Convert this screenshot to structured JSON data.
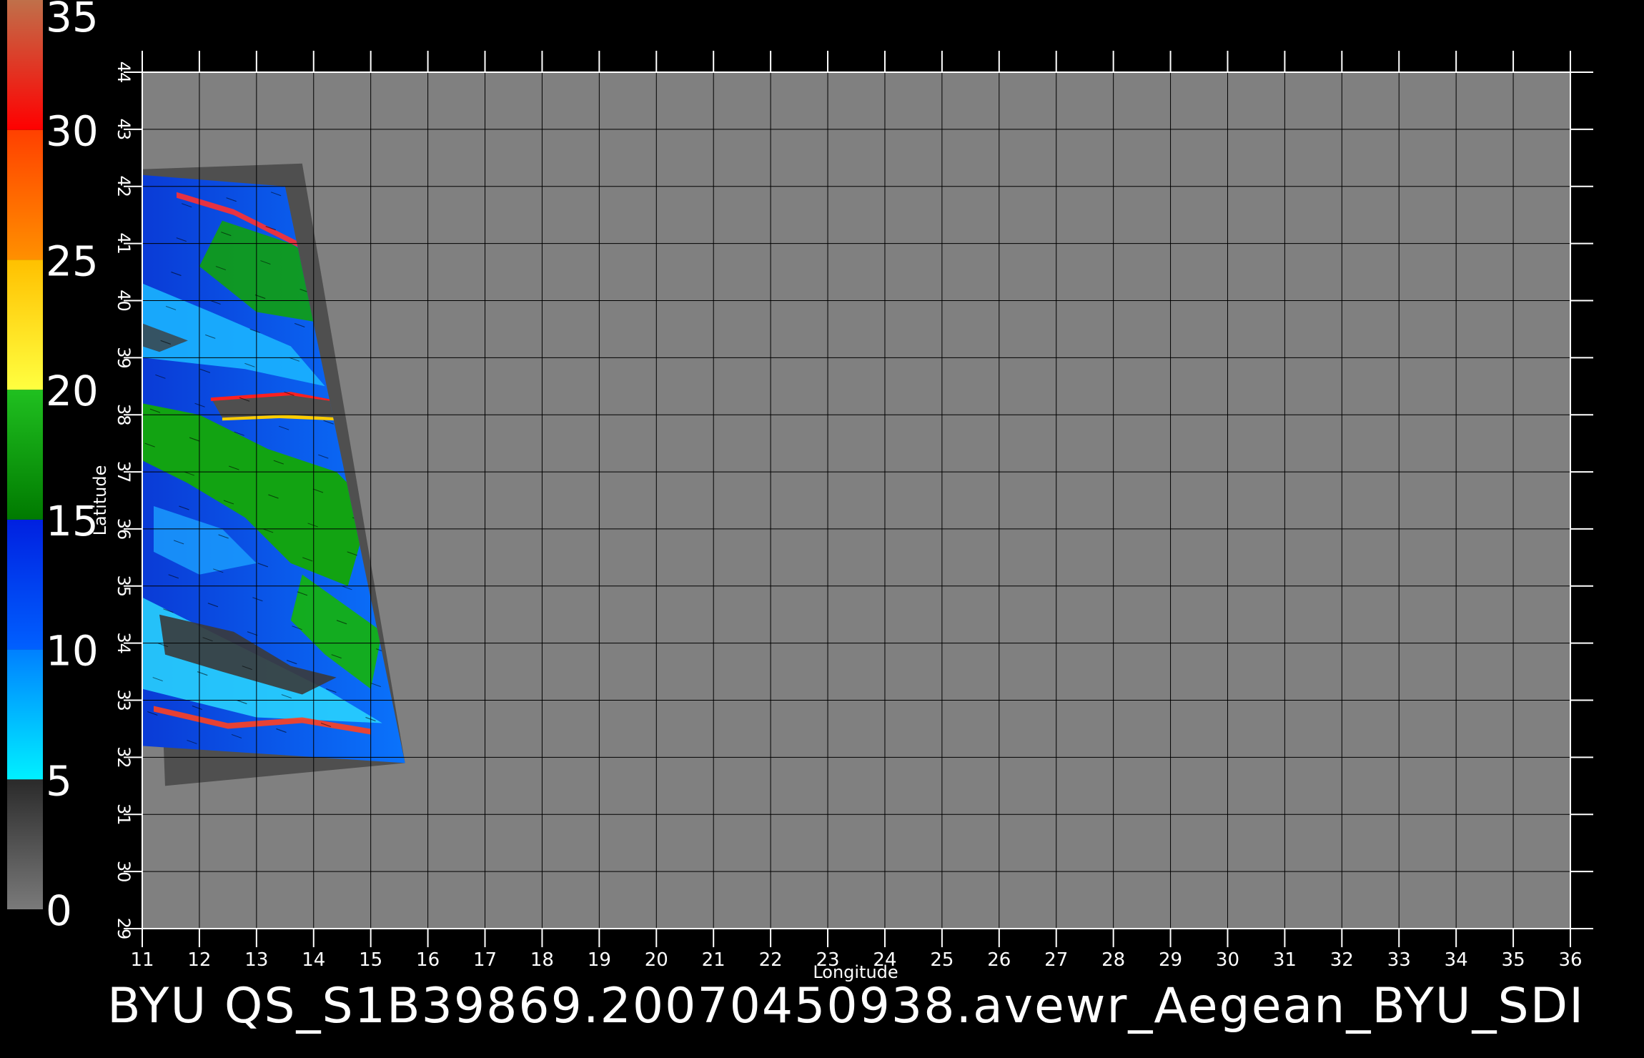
{
  "chart_data": {
    "type": "heatmap",
    "title": "BYU QS_S1B39869.20070450938.avewr_Aegean_BYU_SDI",
    "xlabel": "Longitude",
    "ylabel": "Latitude",
    "xlim": [
      11,
      36
    ],
    "ylim": [
      29,
      44
    ],
    "x_ticks": [
      "11",
      "12",
      "13",
      "14",
      "15",
      "16",
      "17",
      "18",
      "19",
      "20",
      "21",
      "22",
      "23",
      "24",
      "25",
      "26",
      "27",
      "28",
      "29",
      "30",
      "31",
      "32",
      "33",
      "34",
      "35",
      "36"
    ],
    "y_ticks": [
      "29",
      "30",
      "31",
      "32",
      "33",
      "34",
      "35",
      "36",
      "37",
      "38",
      "39",
      "40",
      "41",
      "42",
      "43",
      "44"
    ],
    "grid": true,
    "colorbar": {
      "range": [
        0,
        35
      ],
      "ticks": [
        "0",
        "5",
        "10",
        "15",
        "20",
        "25",
        "30",
        "35"
      ],
      "bands": [
        {
          "from": 0,
          "to": 5,
          "colors": [
            "#7a7a7a",
            "#2a2a2a"
          ]
        },
        {
          "from": 5,
          "to": 10,
          "colors": [
            "#00f0ff",
            "#0080ff"
          ]
        },
        {
          "from": 10,
          "to": 15,
          "colors": [
            "#0060ff",
            "#0020e0"
          ]
        },
        {
          "from": 15,
          "to": 20,
          "colors": [
            "#007a00",
            "#20c020"
          ]
        },
        {
          "from": 20,
          "to": 25,
          "colors": [
            "#ffff40",
            "#ffc000"
          ]
        },
        {
          "from": 25,
          "to": 30,
          "colors": [
            "#ff9000",
            "#ff4000"
          ]
        },
        {
          "from": 30,
          "to": 35,
          "colors": [
            "#ff0000",
            "#c0704a"
          ]
        }
      ]
    },
    "swath": {
      "corners_lonlat": [
        [
          11.0,
          42.3
        ],
        [
          13.8,
          42.4
        ],
        [
          15.6,
          31.9
        ],
        [
          11.4,
          31.5
        ]
      ],
      "data_region_lonlat": [
        [
          11.0,
          42.2
        ],
        [
          13.5,
          42.0
        ],
        [
          15.6,
          31.9
        ],
        [
          11.0,
          32.2
        ]
      ]
    },
    "colors": {
      "background": "#000000",
      "plot_fill": "#808080",
      "grid": "#000000",
      "swath_nodata": "#4f4f4f"
    }
  }
}
